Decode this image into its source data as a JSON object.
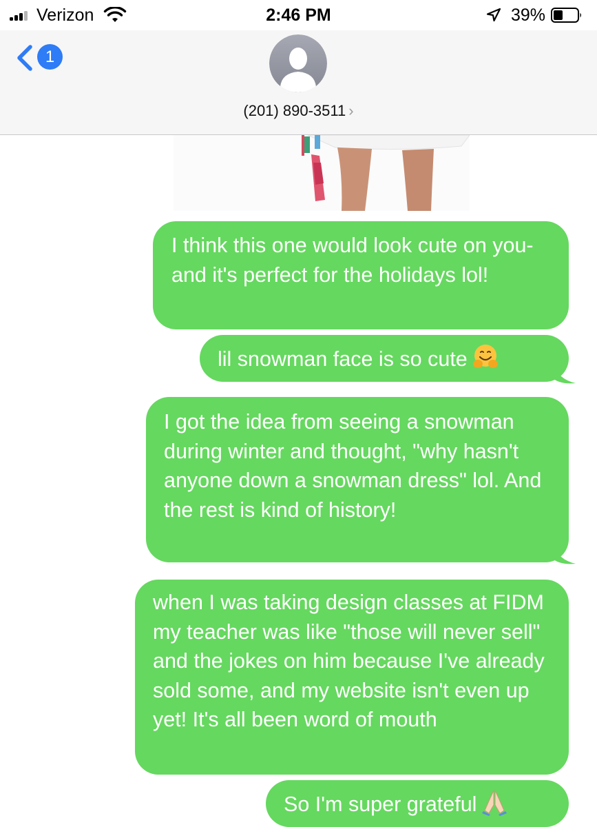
{
  "status_bar": {
    "carrier": "Verizon",
    "time": "2:46 PM",
    "battery_percent": "39%",
    "icons": [
      "signal-icon",
      "wifi-icon",
      "location-arrow-icon",
      "battery-icon"
    ]
  },
  "header": {
    "unread_count": "1",
    "contact_name": "(201) 890-3511",
    "chevron": "›",
    "icons": [
      "back-chevron-icon",
      "contact-avatar-icon",
      "chevron-right-icon"
    ]
  },
  "messages": [
    {
      "text": "I think this one would look cute on you- and it's perfect for the holidays lol!"
    },
    {
      "text": "lil snowman face is so cute",
      "emoji_icon": "hugging-face-icon"
    },
    {
      "text": "I got the idea from seeing a snowman during winter and thought, \"why hasn't anyone down a snowman dress\" lol. And the rest is kind of history!"
    },
    {
      "text": "when I was taking design classes at FIDM my teacher was like \"those will never sell\" and the jokes on him because I've already sold some, and my website isn't even up yet! It's all been word of mouth"
    },
    {
      "text": "So I'm super grateful",
      "emoji_icon": "folded-hands-icon"
    }
  ],
  "colors": {
    "bubble": "#65d85f",
    "header_bg": "#f6f6f6",
    "accent": "#2e7cf6"
  }
}
